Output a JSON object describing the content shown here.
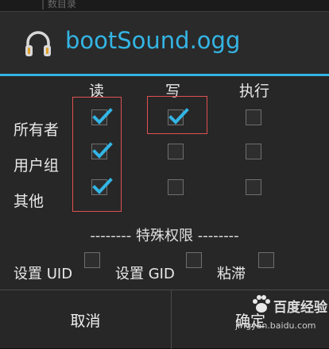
{
  "background": {
    "ghost_text": "| 数目录"
  },
  "dialog": {
    "title": "bootSound.ogg",
    "title_icon": "headphones-icon",
    "accent_color": "#33b5e5"
  },
  "permissions": {
    "columns": [
      "读",
      "写",
      "执行"
    ],
    "rows": [
      {
        "label": "所有者",
        "read": true,
        "write": true,
        "execute": false
      },
      {
        "label": "用户组",
        "read": true,
        "write": false,
        "execute": false
      },
      {
        "label": "其他",
        "read": true,
        "write": false,
        "execute": false
      }
    ]
  },
  "special": {
    "header": "-------- 特殊权限 --------",
    "options": [
      {
        "label": "设置 UID",
        "checked": false
      },
      {
        "label": "设置 GID",
        "checked": false
      },
      {
        "label": "粘滞",
        "checked": false
      }
    ]
  },
  "buttons": {
    "cancel": "取消",
    "ok": "确定"
  },
  "watermark": {
    "text": "百度经验",
    "url": "jingyan.baidu.com"
  },
  "highlight_color": "#e05050"
}
